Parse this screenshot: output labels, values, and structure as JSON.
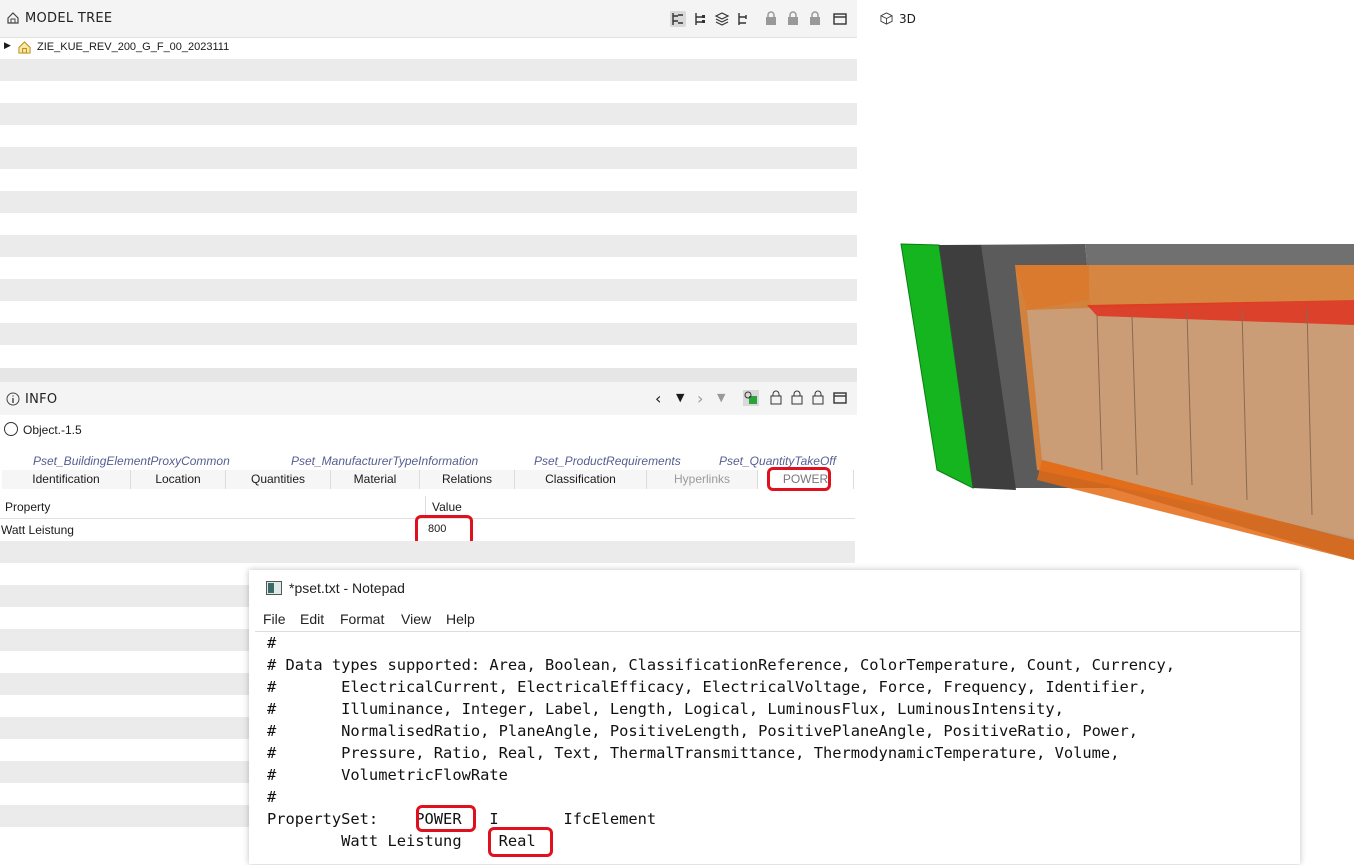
{
  "model_tree": {
    "title": "MODEL TREE",
    "root_label": "ZIE_KUE_REV_200_G_F_00_2023111",
    "toolbar_icons": [
      "hierarchy-icon",
      "tree-icon",
      "layers-icon",
      "relations-icon",
      "lock-icon",
      "lock-icon",
      "lock-icon",
      "maximize-icon"
    ]
  },
  "info": {
    "title": "INFO",
    "object_label": "Object.-1.5",
    "pset_tabs": [
      "Pset_BuildingElementProxyCommon",
      "Pset_ManufacturerTypeInformation",
      "Pset_ProductRequirements",
      "Pset_QuantityTakeOff"
    ],
    "tabs": [
      "Identification",
      "Location",
      "Quantities",
      "Material",
      "Relations",
      "Classification",
      "Hyperlinks",
      "POWER"
    ],
    "columns": {
      "property": "Property",
      "value": "Value"
    },
    "row": {
      "property": "Watt Leistung",
      "value": "800"
    }
  },
  "viewer": {
    "title": "3D"
  },
  "notepad": {
    "title": "*pset.txt - Notepad",
    "menu": [
      "File",
      "Edit",
      "Format",
      "View",
      "Help"
    ],
    "lines": [
      "#",
      "# Data types supported: Area, Boolean, ClassificationReference, ColorTemperature, Count, Currency,",
      "#       ElectricalCurrent, ElectricalEfficacy, ElectricalVoltage, Force, Frequency, Identifier,",
      "#       Illuminance, Integer, Label, Length, Logical, LuminousFlux, LuminousIntensity,",
      "#       NormalisedRatio, PlaneAngle, PositiveLength, PositivePlaneAngle, PositiveRatio, Power,",
      "#       Pressure, Ratio, Real, Text, ThermalTransmittance, ThermodynamicTemperature, Volume,",
      "#       VolumetricFlowRate",
      "#",
      "PropertySet:    POWER   I       IfcElement",
      "        Watt Leistung    Real"
    ]
  },
  "colors": {
    "highlight": "#e0111e",
    "accent": "#555e92",
    "green": "#14b51e",
    "orange": "#e9893a"
  }
}
